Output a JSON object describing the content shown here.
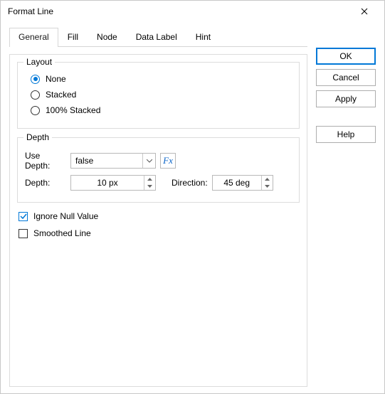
{
  "title": "Format Line",
  "tabs": {
    "t0": "General",
    "t1": "Fill",
    "t2": "Node",
    "t3": "Data Label",
    "t4": "Hint"
  },
  "layout": {
    "legend": "Layout",
    "r0": "None",
    "r1": "Stacked",
    "r2": "100% Stacked"
  },
  "depth": {
    "legend": "Depth",
    "use_depth_lbl": "Use Depth:",
    "use_depth_val": "false",
    "fx_label": "Fx",
    "depth_lbl": "Depth:",
    "depth_val": "10 px",
    "direction_lbl": "Direction:",
    "direction_val": "45 deg"
  },
  "checks": {
    "ignore_null": "Ignore Null Value",
    "smoothed": "Smoothed Line"
  },
  "buttons": {
    "ok": "OK",
    "cancel": "Cancel",
    "apply": "Apply",
    "help": "Help"
  }
}
